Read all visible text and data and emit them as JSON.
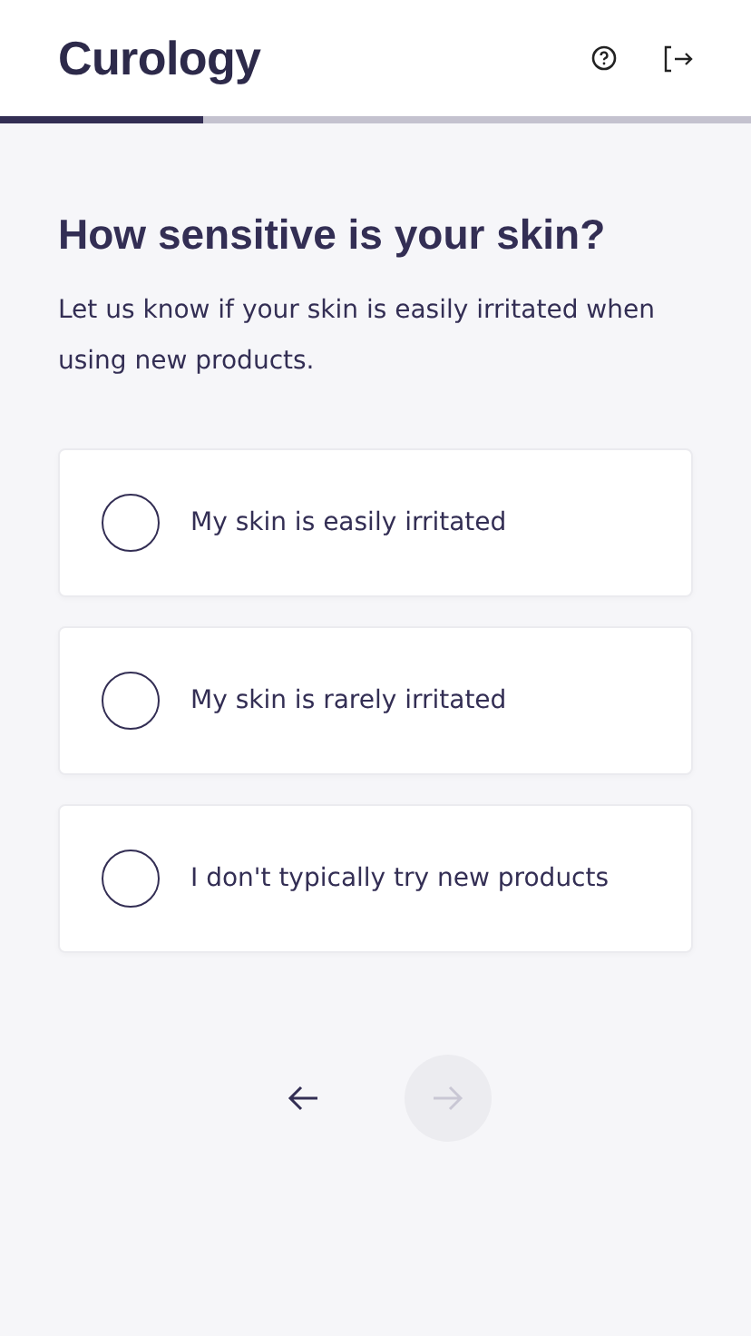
{
  "header": {
    "logo": "Curology"
  },
  "progress": {
    "level": 0.27
  },
  "question": {
    "title": "How sensitive is your skin?",
    "subtitle": "Let us know if your skin is easily irritated when using new products."
  },
  "options": [
    {
      "label": "My skin is easily irritated",
      "selected": false
    },
    {
      "label": "My skin is rarely irritated",
      "selected": false
    },
    {
      "label": "I don't typically try new products",
      "selected": false
    }
  ],
  "navigation": {
    "next_disabled": true
  }
}
